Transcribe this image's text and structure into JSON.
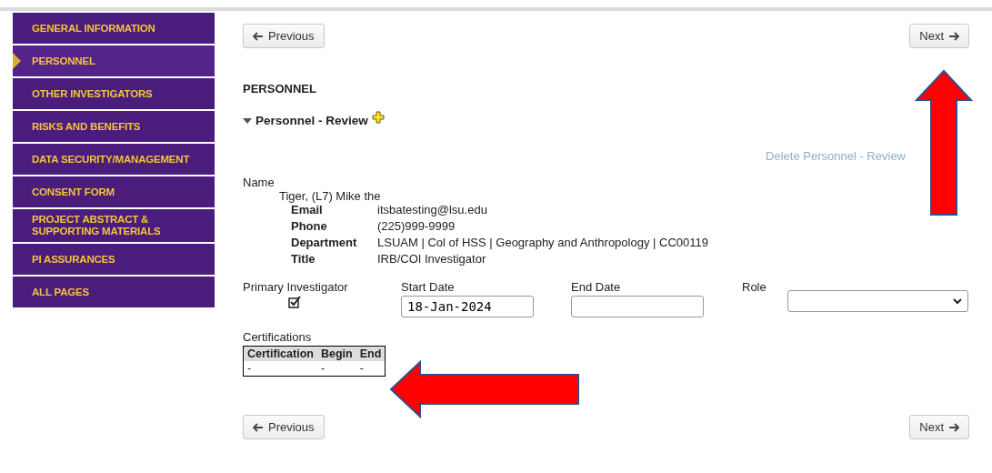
{
  "sidebar": {
    "items": [
      {
        "label": "GENERAL INFORMATION",
        "selected": false
      },
      {
        "label": "PERSONNEL",
        "selected": true
      },
      {
        "label": "OTHER INVESTIGATORS",
        "selected": false
      },
      {
        "label": "RISKS AND BENEFITS",
        "selected": false
      },
      {
        "label": "DATA SECURITY/MANAGEMENT",
        "selected": false
      },
      {
        "label": "CONSENT FORM",
        "selected": false
      },
      {
        "label": "PROJECT ABSTRACT & SUPPORTING MATERIALS",
        "selected": false
      },
      {
        "label": "PI ASSURANCES",
        "selected": false
      },
      {
        "label": "ALL PAGES",
        "selected": false
      }
    ]
  },
  "top_nav": {
    "previous": "Previous",
    "next": "Next"
  },
  "section_title": "PERSONNEL",
  "review": {
    "label": "Personnel - Review",
    "expanded": true
  },
  "delete_link": "Delete Personnel - Review",
  "person": {
    "name_label": "Name",
    "name": "Tiger, (L7) Mike the",
    "details": [
      {
        "label": "Email",
        "value": "itsbatesting@lsu.edu"
      },
      {
        "label": "Phone",
        "value": "(225)999-9999"
      },
      {
        "label": "Department",
        "value": "LSUAM | Col of HSS | Geography and Anthropology | CC00119"
      },
      {
        "label": "Title",
        "value": "IRB/COI Investigator"
      }
    ]
  },
  "fields": {
    "primary_investigator": {
      "label": "Primary Investigator",
      "checked": true
    },
    "start_date": {
      "label": "Start Date",
      "value": "18-Jan-2024"
    },
    "end_date": {
      "label": "End Date"
    },
    "role": {
      "label": "Role"
    }
  },
  "certifications": {
    "title": "Certifications",
    "columns": [
      "Certification",
      "Begin",
      "End"
    ],
    "rows": [
      [
        "-",
        "-",
        "-"
      ]
    ]
  },
  "bottom_nav": {
    "previous": "Previous",
    "next": "Next"
  },
  "annotations": [
    {
      "kind": "up"
    },
    {
      "kind": "left"
    }
  ]
}
